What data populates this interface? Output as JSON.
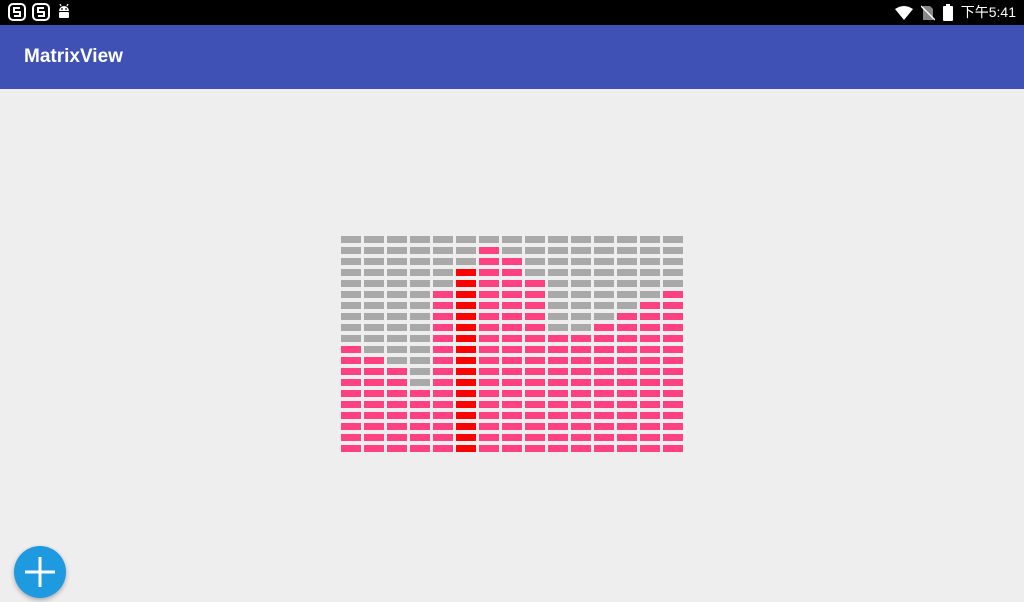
{
  "status_bar": {
    "time": "下午5:41",
    "left_icons": [
      "s-app-icon",
      "s-app-icon",
      "android-debug-icon"
    ],
    "right_icons": [
      "wifi-icon",
      "no-sim-icon",
      "battery-icon"
    ]
  },
  "app_bar": {
    "title": "MatrixView",
    "color": "#3f51b5"
  },
  "matrix": {
    "columns": 15,
    "rows": 20,
    "off_color": "#a9a9a9",
    "on_color": "#ff4081",
    "highlight_color": "#ff0000",
    "highlight_column": 5,
    "lit_counts": [
      10,
      9,
      8,
      6,
      15,
      17,
      19,
      18,
      16,
      11,
      11,
      12,
      13,
      14,
      15
    ]
  },
  "fab": {
    "icon": "plus-icon",
    "color": "#1e9ae0"
  }
}
